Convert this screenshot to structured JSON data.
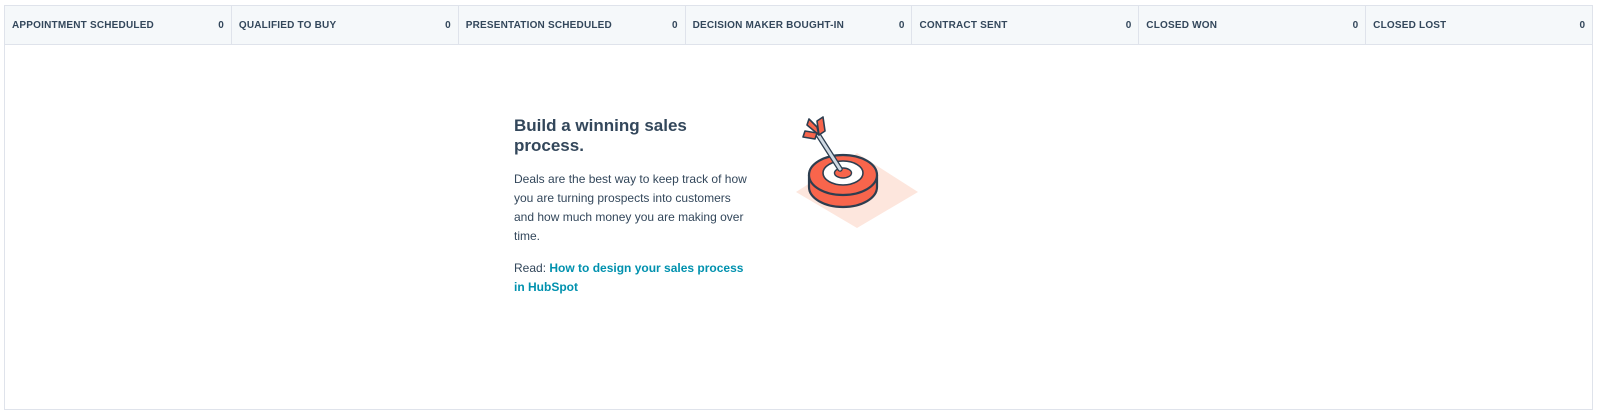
{
  "pipeline": {
    "stages": [
      {
        "name": "APPOINTMENT SCHEDULED",
        "count": "0"
      },
      {
        "name": "QUALIFIED TO BUY",
        "count": "0"
      },
      {
        "name": "PRESENTATION SCHEDULED",
        "count": "0"
      },
      {
        "name": "DECISION MAKER BOUGHT-IN",
        "count": "0"
      },
      {
        "name": "CONTRACT SENT",
        "count": "0"
      },
      {
        "name": "CLOSED WON",
        "count": "0"
      },
      {
        "name": "CLOSED LOST",
        "count": "0"
      }
    ]
  },
  "empty_state": {
    "title": "Build a winning sales process.",
    "description": "Deals are the best way to keep track of how you are turning prospects into customers and how much money you are making over time.",
    "read_prefix": "Read:",
    "read_link": "How to design your sales process in HubSpot",
    "illustration_icon": "target-dart-icon"
  },
  "colors": {
    "accent_link": "#0091ae",
    "target_red": "#f8654c",
    "target_shadow": "#fde6dd",
    "text_primary": "#33475b",
    "header_bg": "#f5f8fa"
  }
}
